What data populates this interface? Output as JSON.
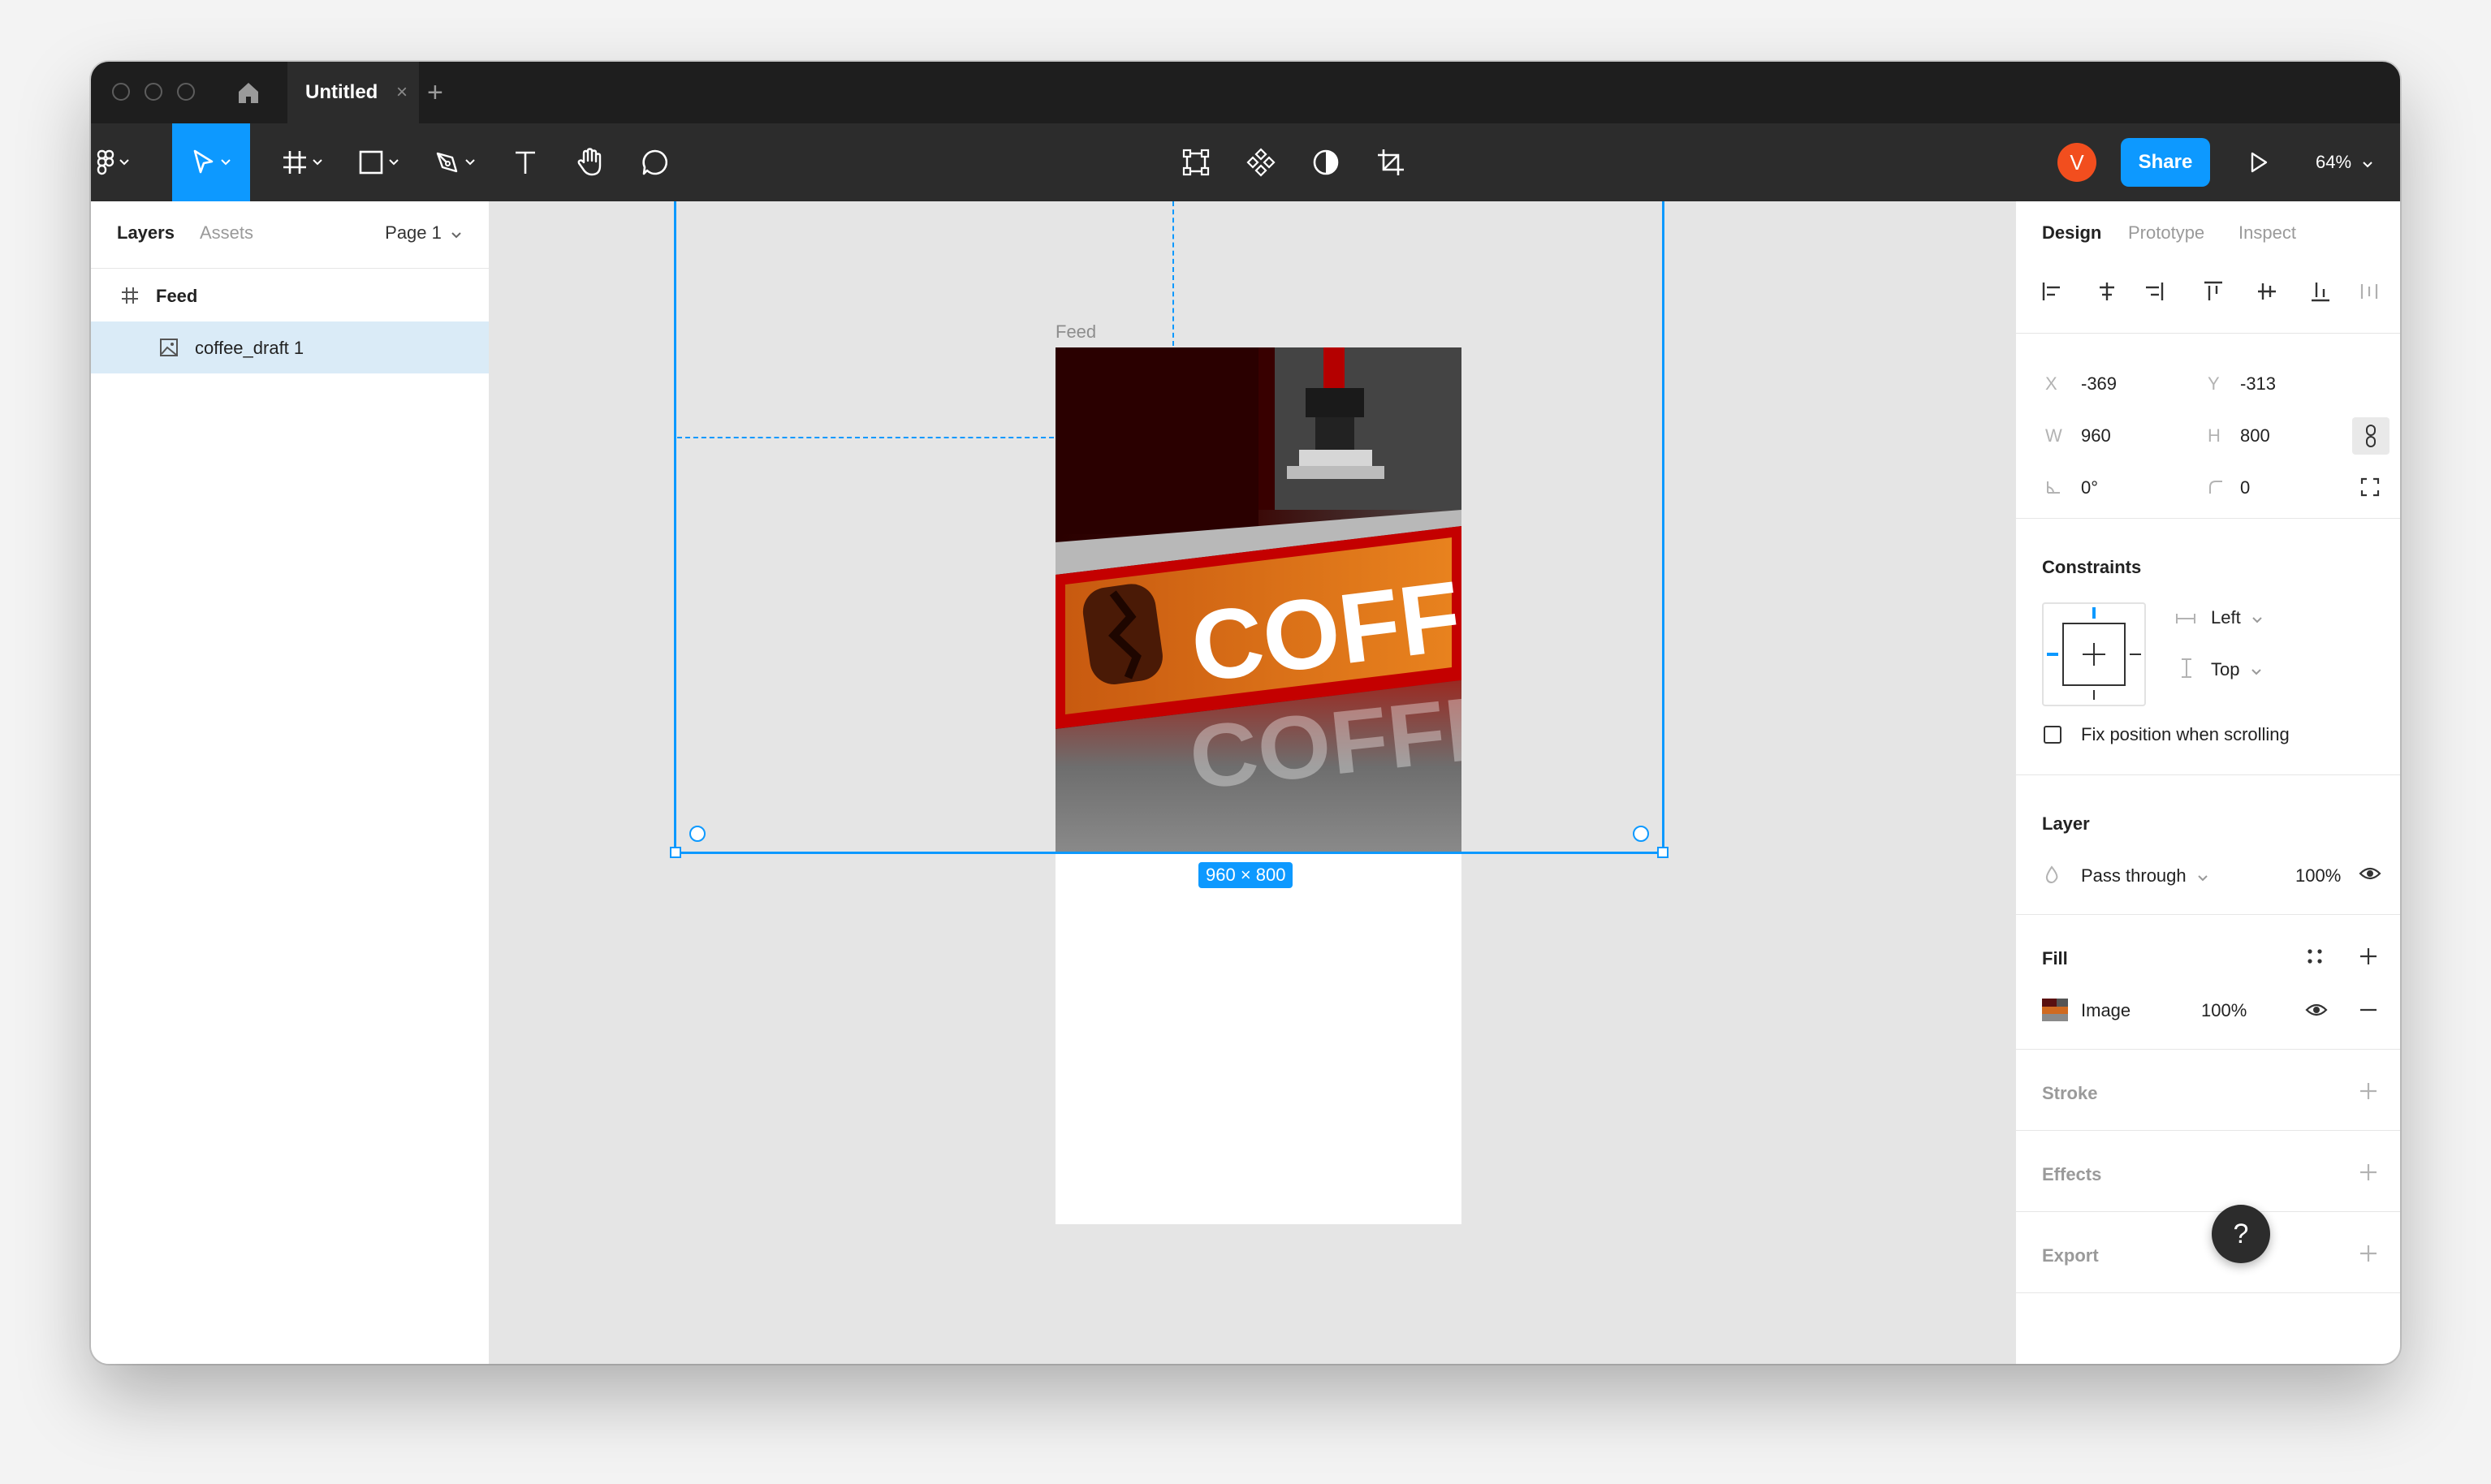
{
  "window": {
    "home_icon": "home-icon",
    "tab_title": "Untitled",
    "tab_close": "×",
    "new_tab": "+"
  },
  "toolbar": {
    "tools": [
      "figma-menu-icon",
      "move-icon",
      "frame-icon",
      "rectangle-icon",
      "pen-icon",
      "text-icon",
      "hand-icon",
      "comment-icon"
    ],
    "center_tools": [
      "edit-object-icon",
      "component-icon",
      "mask-icon",
      "crop-icon"
    ],
    "avatar_initial": "V",
    "share_label": "Share",
    "zoom_label": "64%"
  },
  "left_panel": {
    "tab_layers": "Layers",
    "tab_assets": "Assets",
    "page_label": "Page 1",
    "layers": [
      {
        "name": "Feed",
        "icon": "frame-icon"
      },
      {
        "name": "coffee_draft 1",
        "icon": "image-icon"
      }
    ]
  },
  "canvas": {
    "frame_label": "Feed",
    "dimensions_badge": "960 × 800",
    "image_sign_text": "COFFEE"
  },
  "right_panel": {
    "tabs": [
      "Design",
      "Prototype",
      "Inspect"
    ],
    "x_label": "X",
    "x_value": "-369",
    "y_label": "Y",
    "y_value": "-313",
    "w_label": "W",
    "w_value": "960",
    "h_label": "H",
    "h_value": "800",
    "rotation_value": "0°",
    "radius_value": "0",
    "constraints_title": "Constraints",
    "constraint_h": "Left",
    "constraint_v": "Top",
    "fix_position_label": "Fix position when scrolling",
    "layer_title": "Layer",
    "blend_mode": "Pass through",
    "layer_opacity": "100%",
    "fill_title": "Fill",
    "fill_type": "Image",
    "fill_opacity": "100%",
    "stroke_title": "Stroke",
    "effects_title": "Effects",
    "export_title": "Export",
    "help_label": "?"
  },
  "colors": {
    "accent": "#0d99ff",
    "toolbar_bg": "#2c2c2c",
    "avatar": "#f24e1e"
  }
}
